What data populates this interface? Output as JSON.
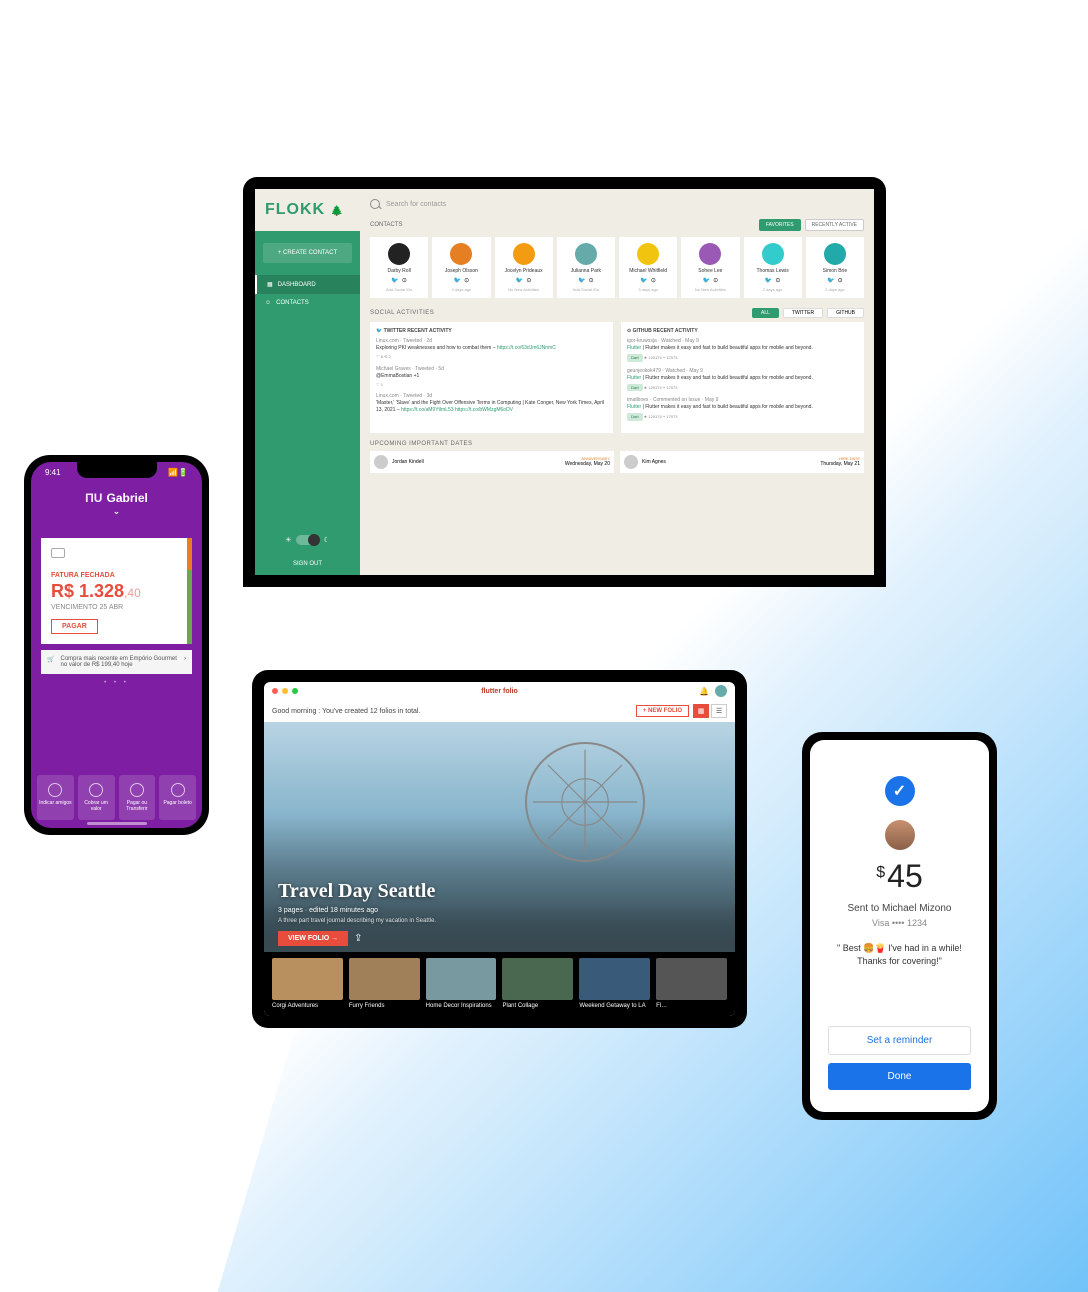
{
  "flokk": {
    "logo": "FLOKK",
    "create_contact": "+ CREATE CONTACT",
    "nav": {
      "dashboard": "DASHBOARD",
      "contacts": "CONTACTS"
    },
    "signout": "SIGN OUT",
    "search_placeholder": "Search for contacts",
    "sections": {
      "contacts": "CONTACTS",
      "social": "SOCIAL ACTIVITIES",
      "dates": "UPCOMING IMPORTANT DATES"
    },
    "pills": {
      "favorites": "FAVORITES",
      "recently": "RECENTLY ACTIVE",
      "all": "ALL",
      "twitter": "TWITTER",
      "github": "GITHUB"
    },
    "contacts_list": [
      {
        "name": "Darby Roll",
        "meta": "Add Social IDs",
        "color": "#222"
      },
      {
        "name": "Joseph Olsson",
        "meta": "4 days ago",
        "color": "#e67e22"
      },
      {
        "name": "Jocelyn Prideaux",
        "meta": "No New Activities",
        "color": "#f39c12"
      },
      {
        "name": "Julianna Park",
        "meta": "Add Social IDs",
        "color": "#6aa"
      },
      {
        "name": "Michael Whitfield",
        "meta": "3 days ago",
        "color": "#f1c40f"
      },
      {
        "name": "Sohee Lee",
        "meta": "No New Activities",
        "color": "#9b59b6"
      },
      {
        "name": "Thomas Lewis",
        "meta": "2 days ago",
        "color": "#3cc"
      },
      {
        "name": "Simon Brie",
        "meta": "2 days ago",
        "color": "#2aa"
      }
    ],
    "twitter_col": {
      "title": "TWITTER RECENT ACTIVITY",
      "items": [
        {
          "meta": "Linux.com · Tweeted · 2d",
          "body": "Exploring PKI weaknesses and how to combat them – ",
          "link": "https://t.co/63dJm6JNnmC",
          "stats": "♡ 6   ⟲ 2"
        },
        {
          "meta": "Michael Graves · Tweeted · 5d",
          "body": "@EmmaBostian +1",
          "stats": "♡ 1"
        },
        {
          "meta": "Linux.com · Tweeted · 3d",
          "body": "'Master,' 'Slave' and the Fight Over Offensive Terms in Computing | Kate Conger, New York Times, April 13, 2021 – ",
          "link": "https://t.co/aM9YtlmL53 https://t.co/bWMzgM6oDV"
        }
      ]
    },
    "github_col": {
      "title": "GITHUB RECENT ACTIVITY",
      "items": [
        {
          "meta": "igor-kruwosja · Watched · May 9",
          "body": "Flutter | Flutter makes it easy and fast to build beautiful apps for mobile and beyond.",
          "badge": "Dart",
          "stats": "★ 120174  ⑂ 17073"
        },
        {
          "meta": "geunjeokok479 · Watched · May 9",
          "body": "Flutter | Flutter makes it easy and fast to build beautiful apps for mobile and beyond.",
          "badge": "Dart",
          "stats": "★ 120174  ⑂ 17073"
        },
        {
          "meta": "tmailboex · Commented on Issue · May 9",
          "body": "Flutter | Flutter makes it easy and fast to build beautiful apps for mobile and beyond.",
          "badge": "Dart",
          "stats": "★ 120174  ⑂ 17073"
        }
      ]
    },
    "dates_list": [
      {
        "name": "Jordan Kindell",
        "label": "ANNIVERSARY",
        "when": "Wednesday, May 20"
      },
      {
        "name": "Kim Agnes",
        "label": "HIRE DATE",
        "when": "Thursday, May 21"
      }
    ]
  },
  "nubank": {
    "time": "9:41",
    "user": "Gabriel",
    "fatura_label": "FATURA FECHADA",
    "amount_main": "R$ 1.328",
    "amount_cents": ",40",
    "vencimento": "VENCIMENTO 25 ABR",
    "pagar_btn": "PAGAR",
    "compra": "Compra mais recente em Empório Gourmet no valor de R$ 199,40 hoje",
    "actions": [
      {
        "label": "Indicar amigos"
      },
      {
        "label": "Cobrar um valor"
      },
      {
        "label": "Pagar ou Transferir"
      },
      {
        "label": "Pagar boleto"
      }
    ]
  },
  "folio": {
    "app_title": "flutter folio",
    "greeting": "Good morning : You've created 12 folios in total.",
    "new_folio": "+ NEW FOLIO",
    "hero": {
      "title": "Travel Day Seattle",
      "sub": "3 pages · edited 18 minutes ago",
      "desc": "A three part travel journal describing my vacation in Seattle.",
      "view_btn": "VIEW FOLIO →"
    },
    "thumbs": [
      {
        "label": "Corgi Adventures",
        "bg": "#b89060"
      },
      {
        "label": "Furry Friends",
        "bg": "#a08058"
      },
      {
        "label": "Home Decor Inspirations",
        "bg": "#7899a0"
      },
      {
        "label": "Plant Collage",
        "bg": "#4a6850"
      },
      {
        "label": "Weekend Getaway to LA",
        "bg": "#3a5a7a"
      },
      {
        "label": "Fl…",
        "bg": "#555"
      }
    ]
  },
  "gpay": {
    "amount": "45",
    "sent_to": "Sent to Michael Mizono",
    "visa": "Visa •••• 1234",
    "msg_line1": "\" Best 🍔🍟 I've had in a while!",
    "msg_line2": "Thanks for covering!\"",
    "reminder_btn": "Set a reminder",
    "done_btn": "Done"
  }
}
